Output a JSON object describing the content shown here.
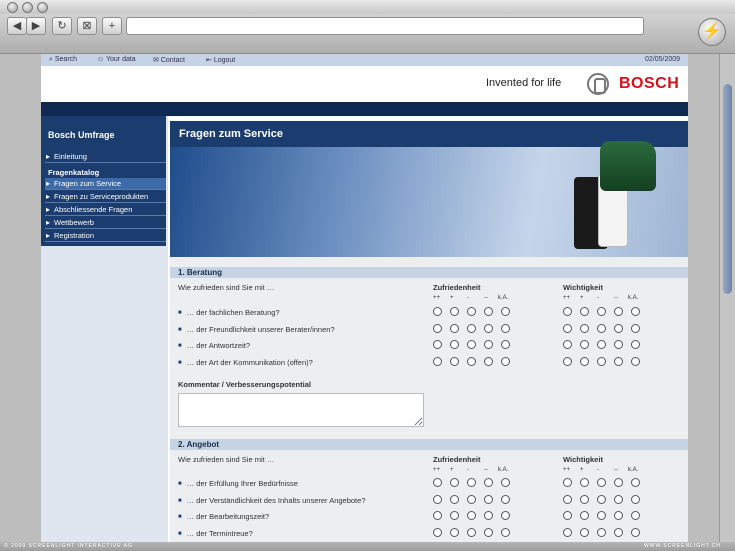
{
  "topnav": {
    "search": "Search",
    "your_data": "Your data",
    "contact": "Contact",
    "logout": "Logout",
    "date": "02/05/2009"
  },
  "header": {
    "tagline": "Invented for life",
    "brand": "BOSCH"
  },
  "sidebar": {
    "title": "Bosch Umfrage",
    "items": [
      {
        "label": "Einleitung"
      },
      {
        "label": "Fragen zum Service"
      },
      {
        "label": "Fragen zu Serviceprodukten"
      },
      {
        "label": "Abschliessende Fragen"
      },
      {
        "label": "Wettbewerb"
      },
      {
        "label": "Registration"
      }
    ],
    "section_label": "Fragenkatalog"
  },
  "banner": {
    "title": "Fragen zum Service"
  },
  "sections": [
    {
      "heading": "1. Beratung",
      "intro": "Wie zufrieden sind Sie mit …",
      "col1": "Zufriedenheit",
      "col2": "Wichtigkeit",
      "scale": [
        "++",
        "+",
        "-",
        "--",
        "k.A."
      ],
      "questions": [
        "… der fachlichen Beratung?",
        "… der Freundlichkeit unserer Berater/innen?",
        "… der Antwortzeit?",
        "… der Art der Kommunikation (offen)?"
      ],
      "comment_label": "Kommentar / Verbesserungspotential"
    },
    {
      "heading": "2. Angebot",
      "intro": "Wie zufrieden sind Sie mit …",
      "col1": "Zufriedenheit",
      "col2": "Wichtigkeit",
      "scale": [
        "++",
        "+",
        "-",
        "--",
        "k.A."
      ],
      "questions": [
        "… der Erfüllung Ihrer Bedürfnisse",
        "… der Verständlichkeit des Inhalts unserer Angebote?",
        "… der Bearbeitungszeit?",
        "… der Termintreue?"
      ]
    }
  ],
  "statusbar": {
    "left": "© 2009 SCREENLIGHT INTERACTIVE AG",
    "right": "WWW.SCREENLIGHT.CH"
  }
}
